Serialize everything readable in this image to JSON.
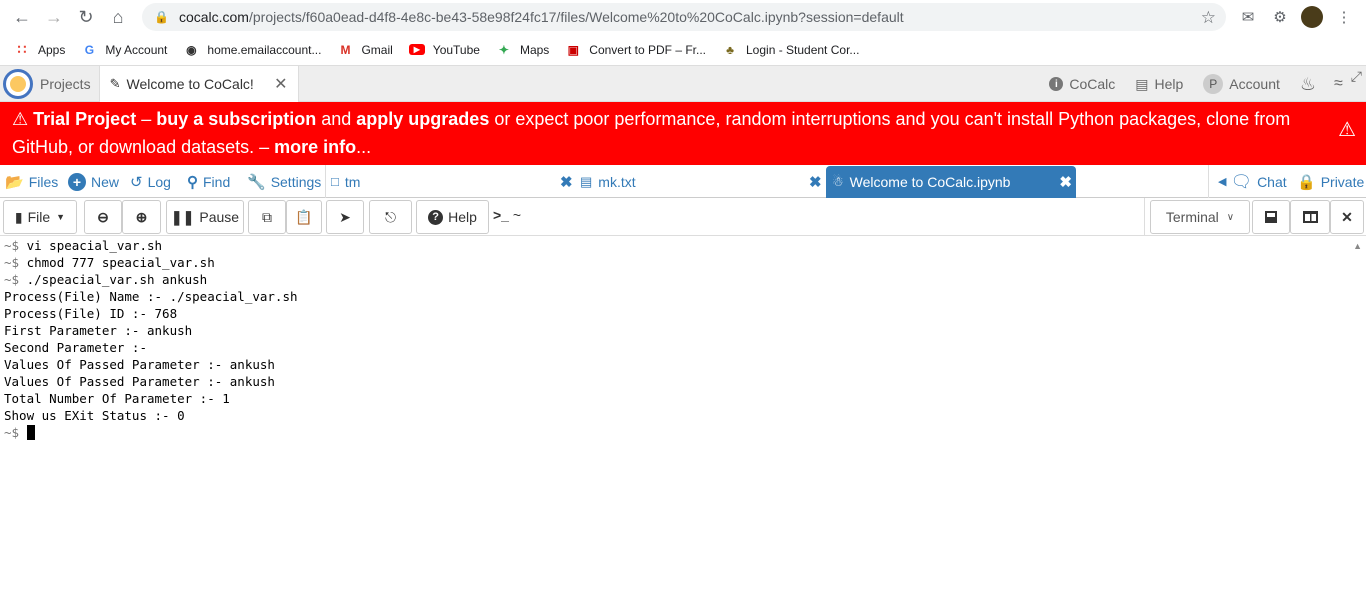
{
  "browser": {
    "url_host": "cocalc.com",
    "url_path": "/projects/f60a0ead-d4f8-4e8c-be43-58e98f24fc17/files/Welcome%20to%20CoCalc.ipynb?session=default",
    "bookmarks": [
      "Apps",
      "My Account",
      "home.emailaccount...",
      "Gmail",
      "YouTube",
      "Maps",
      "Convert to PDF – Fr...",
      "Login - Student Cor..."
    ]
  },
  "cocalc": {
    "projects_label": "Projects",
    "active_tab": "Welcome to CoCalc!",
    "right_menu": {
      "cocalc": "CoCalc",
      "help": "Help",
      "account": "Account",
      "account_initial": "P"
    }
  },
  "banner": {
    "trial": "Trial Project",
    "dash1": " – ",
    "buy": "buy a subscription",
    "and": " and ",
    "apply": "apply upgrades",
    "rest": " or expect poor performance, random interruptions and you can't install Python packages, clone from GitHub, or download datasets. – ",
    "more": "more info",
    "ellipsis": "..."
  },
  "file_tabs": {
    "files": "Files",
    "new": "New",
    "log": "Log",
    "find": "Find",
    "settings": "Settings",
    "open": [
      {
        "name": "tm"
      },
      {
        "name": "mk.txt"
      },
      {
        "name": "Welcome to CoCalc.ipynb"
      }
    ],
    "chat": "Chat",
    "private": "Private"
  },
  "toolbar": {
    "file": "File",
    "pause": "Pause",
    "help": "Help",
    "path_label": "~",
    "terminal_select": "Terminal"
  },
  "terminal": {
    "lines": [
      {
        "prompt": "~$",
        "text": " vi speacial_var.sh"
      },
      {
        "prompt": "~$",
        "text": " chmod 777 speacial_var.sh"
      },
      {
        "prompt": "~$",
        "text": " ./speacial_var.sh ankush"
      },
      {
        "prompt": "",
        "text": "Process(File) Name :- ./speacial_var.sh"
      },
      {
        "prompt": "",
        "text": "Process(File) ID :- 768"
      },
      {
        "prompt": "",
        "text": "First Parameter :- ankush"
      },
      {
        "prompt": "",
        "text": "Second Parameter :-"
      },
      {
        "prompt": "",
        "text": "Values Of Passed Parameter :- ankush"
      },
      {
        "prompt": "",
        "text": "Values Of Passed Parameter :- ankush"
      },
      {
        "prompt": "",
        "text": "Total Number Of Parameter :- 1"
      },
      {
        "prompt": "",
        "text": "Show us EXit Status :- 0"
      }
    ],
    "current_prompt": "~$"
  }
}
